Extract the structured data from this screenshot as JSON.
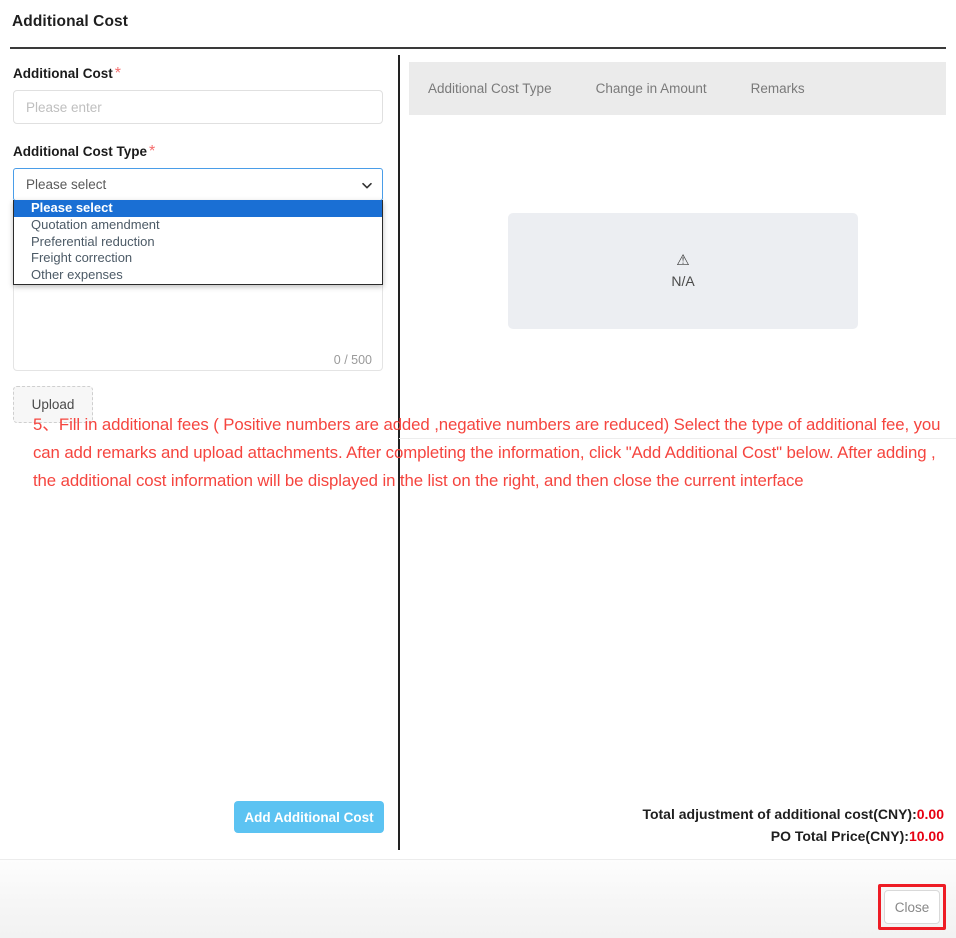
{
  "dialog": {
    "title": "Additional Cost"
  },
  "form": {
    "cost": {
      "label": "Additional Cost",
      "required_mark": "*",
      "placeholder": "Please enter",
      "value": ""
    },
    "cost_type": {
      "label": "Additional Cost Type",
      "required_mark": "*",
      "selected": "Please select",
      "options": [
        "Please select",
        "Quotation amendment",
        "Preferential reduction",
        "Freight correction",
        "Other expenses"
      ],
      "chevron_icon": "chevron-down-icon"
    },
    "remarks": {
      "value": "",
      "counter": "0 / 500",
      "max_length": 500
    },
    "upload": {
      "label": "Upload"
    },
    "submit": {
      "label": "Add Additional Cost"
    }
  },
  "note": {
    "text": "5、Fill in additional fees ( Positive numbers are added ,negative numbers are reduced) Select the type of additional fee, you can add remarks and upload attachments. After completing the information, click \"Add Additional Cost\" below. After adding , the additional cost information will be displayed in the list on the right, and then close the current interface",
    "color": "#f5453f"
  },
  "table": {
    "headers": [
      "Additional Cost Type",
      "Change in Amount",
      "Remarks"
    ],
    "rows": [],
    "empty_state": {
      "icon": "warning-triangle-icon",
      "glyph": "⚠",
      "text": "N/A"
    }
  },
  "totals": {
    "adjustment_label": "Total adjustment of additional cost(CNY):",
    "adjustment_value": "0.00",
    "po_total_label": "PO Total Price(CNY):",
    "po_total_value": "10.00",
    "value_color": "#e60012"
  },
  "footer": {
    "close_label": "Close"
  }
}
